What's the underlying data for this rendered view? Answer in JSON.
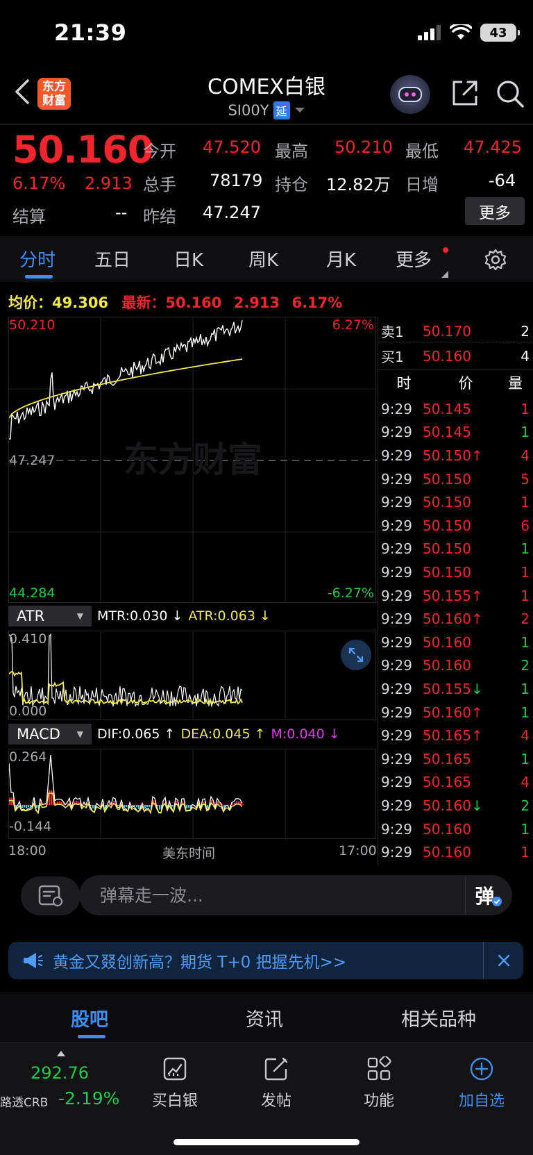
{
  "status_bar": {
    "time": "21:39",
    "battery": "43"
  },
  "header": {
    "logo_line1": "东方",
    "logo_line2": "财富",
    "title": "COMEX白银",
    "code": "SI00Y",
    "delay_badge": "延"
  },
  "quote": {
    "last_price": "50.160",
    "change_pct": "6.17%",
    "change": "2.913",
    "open_label": "今开",
    "open": "47.520",
    "high_label": "最高",
    "high": "50.210",
    "low_label": "最低",
    "low": "47.425",
    "volume_label": "总手",
    "volume": "78179",
    "position_label": "持仓",
    "position": "12.82万",
    "daily_inc_label": "日增",
    "daily_inc": "-64",
    "settle_label": "结算",
    "settle": "--",
    "prev_settle_label": "昨结",
    "prev_settle": "47.247",
    "more_button": "更多"
  },
  "tabs": [
    {
      "label": "分时",
      "active": true
    },
    {
      "label": "五日"
    },
    {
      "label": "日K"
    },
    {
      "label": "周K"
    },
    {
      "label": "月K"
    },
    {
      "label": "更多"
    }
  ],
  "info_line": {
    "avg_label": "均价：",
    "avg": "49.306",
    "latest_label": "最新：",
    "latest": "50.160",
    "change": "2.913",
    "change_pct": "6.17%"
  },
  "main_chart": {
    "top_value": "50.210",
    "top_pct": "6.27%",
    "mid_value": "47.247",
    "bottom_value": "44.284",
    "bottom_pct": "-6.27%",
    "watermark": "东方财富"
  },
  "atr": {
    "tag": "ATR",
    "mtr": "MTR:0.030 ↓",
    "atr": "ATR:0.063 ↓",
    "top_value": "0.410",
    "bottom_value": "0.000"
  },
  "macd": {
    "tag": "MACD",
    "dif": "DIF:0.065 ↑",
    "dea": "DEA:0.045 ↑",
    "m": "M:0.040 ↓",
    "top_value": "0.264",
    "bottom_value": "-0.144"
  },
  "time_axis": {
    "start": "18:00",
    "middle": "美东时间",
    "end": "17:00"
  },
  "order_book": {
    "sell_label": "卖1",
    "sell_price": "50.170",
    "sell_vol": "2",
    "buy_label": "买1",
    "buy_price": "50.160",
    "buy_vol": "4",
    "col_time": "时",
    "col_price": "价",
    "col_vol": "量",
    "ticks": [
      {
        "time": "9:29",
        "price": "50.145",
        "vol": "1",
        "vol_color": "red"
      },
      {
        "time": "9:29",
        "price": "50.145",
        "vol": "1",
        "vol_color": "green"
      },
      {
        "time": "9:29",
        "price": "50.150↑",
        "vol": "4",
        "vol_color": "red"
      },
      {
        "time": "9:29",
        "price": "50.150",
        "vol": "5",
        "vol_color": "red"
      },
      {
        "time": "9:29",
        "price": "50.150",
        "vol": "1",
        "vol_color": "red"
      },
      {
        "time": "9:29",
        "price": "50.150",
        "vol": "6",
        "vol_color": "red"
      },
      {
        "time": "9:29",
        "price": "50.150",
        "vol": "1",
        "vol_color": "green"
      },
      {
        "time": "9:29",
        "price": "50.150",
        "vol": "1",
        "vol_color": "red"
      },
      {
        "time": "9:29",
        "price": "50.155↑",
        "vol": "1",
        "vol_color": "red"
      },
      {
        "time": "9:29",
        "price": "50.160↑",
        "vol": "2",
        "vol_color": "red"
      },
      {
        "time": "9:29",
        "price": "50.160",
        "vol": "1",
        "vol_color": "green"
      },
      {
        "time": "9:29",
        "price": "50.160",
        "vol": "2",
        "vol_color": "green"
      },
      {
        "time": "9:29",
        "price": "50.155↓",
        "vol": "1",
        "vol_color": "green"
      },
      {
        "time": "9:29",
        "price": "50.160↑",
        "vol": "1",
        "vol_color": "green"
      },
      {
        "time": "9:29",
        "price": "50.165↑",
        "vol": "4",
        "vol_color": "red"
      },
      {
        "time": "9:29",
        "price": "50.165",
        "vol": "1",
        "vol_color": "green"
      },
      {
        "time": "9:29",
        "price": "50.165",
        "vol": "4",
        "vol_color": "red"
      },
      {
        "time": "9:29",
        "price": "50.160↓",
        "vol": "2",
        "vol_color": "green"
      },
      {
        "time": "9:29",
        "price": "50.160",
        "vol": "1",
        "vol_color": "green"
      },
      {
        "time": "9:29",
        "price": "50.160",
        "vol": "1",
        "vol_color": "red"
      }
    ]
  },
  "danmaku": {
    "placeholder": "弹幕走一波...",
    "send": "弹"
  },
  "promo": {
    "text": "黄金又叕创新高？期货 T+0 把握先机>>"
  },
  "bottom_tabs": [
    {
      "label": "股吧",
      "active": true
    },
    {
      "label": "资讯"
    },
    {
      "label": "相关品种"
    }
  ],
  "bottom_bar": {
    "crb_value": "292.76",
    "crb_label": "路透CRB",
    "crb_change": "-2.19%",
    "buy": "买白银",
    "post": "发帖",
    "functions": "功能",
    "add_watch": "加自选"
  },
  "colors": {
    "up": "#f0252d",
    "down": "#1fcc4a",
    "accent": "#3f8ef0",
    "avg_line": "#f2e94e"
  }
}
